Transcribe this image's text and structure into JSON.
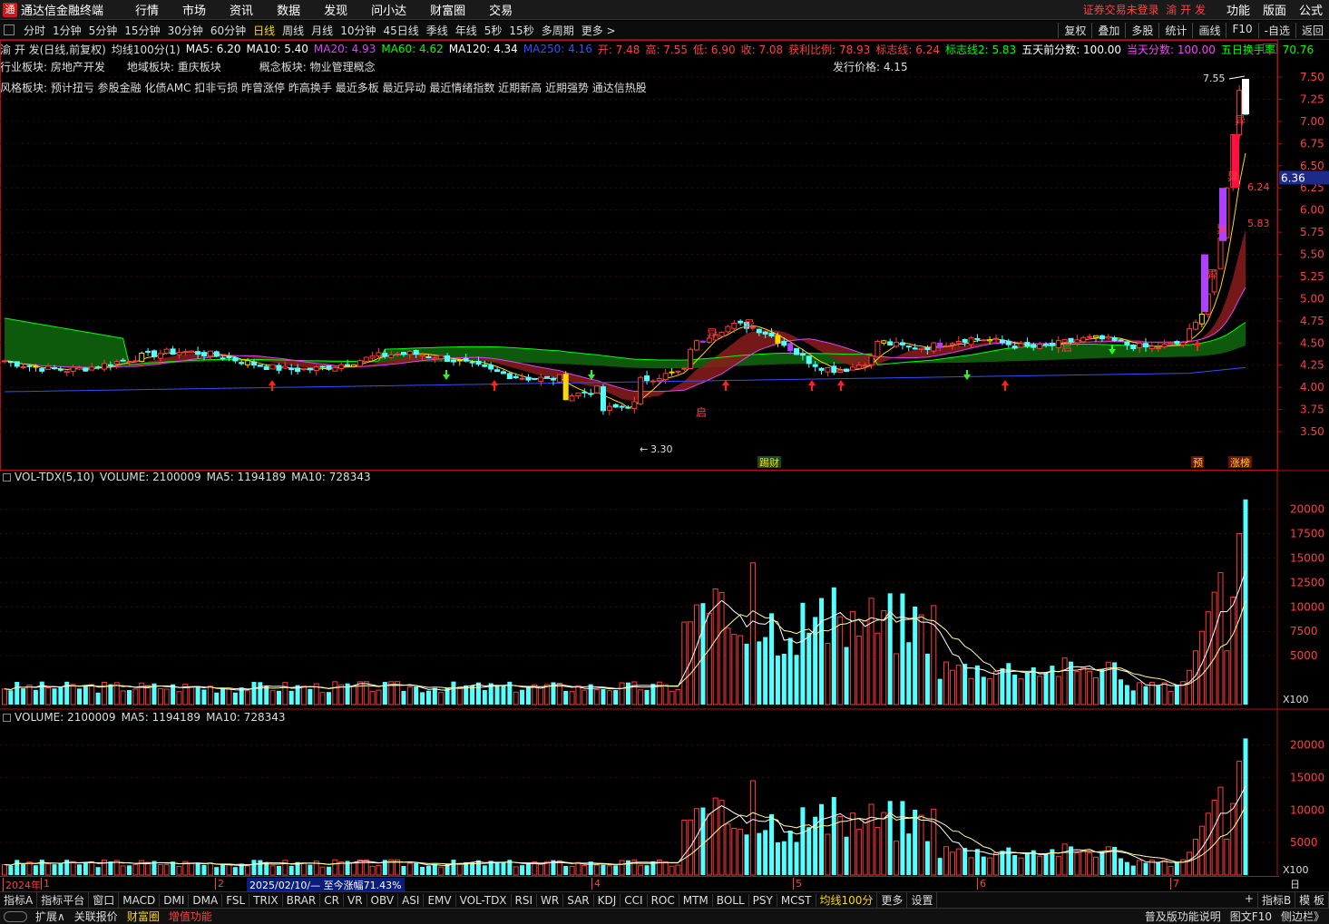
{
  "app": {
    "title": "通达信金融终端",
    "logo": "通"
  },
  "menu": [
    "行情",
    "市场",
    "资讯",
    "数据",
    "发现",
    "问小达",
    "财富圈",
    "交易"
  ],
  "login_warning": "证券交易未登录",
  "stock_name_top": "渝 开 发",
  "right_menu": [
    "功能",
    "版面",
    "公式"
  ],
  "periods": [
    "分时",
    "1分钟",
    "5分钟",
    "15分钟",
    "30分钟",
    "60分钟",
    "日线",
    "周线",
    "月线",
    "10分钟",
    "45日线",
    "季线",
    "年线",
    "5秒",
    "15秒",
    "多周期",
    "更多 >"
  ],
  "active_period": "日线",
  "right_tools": [
    "复权",
    "叠加",
    "多股",
    "统计",
    "画线",
    "F10",
    "-自选",
    "返回"
  ],
  "ma_line": [
    {
      "text": "渝 开 发(日线,前复权)",
      "color": "#dddddd"
    },
    {
      "text": "均线100分(1)",
      "color": "#dddddd"
    },
    {
      "text": "MA5: 6.20",
      "color": "#ffffff"
    },
    {
      "text": "MA10: 5.40",
      "color": "#ffffff"
    },
    {
      "text": "MA20: 4.93",
      "color": "#e040fb"
    },
    {
      "text": "MA60: 4.62",
      "color": "#00ff00"
    },
    {
      "text": "MA120: 4.34",
      "color": "#ffffff"
    },
    {
      "text": "MA250: 4.16",
      "color": "#3050ff"
    },
    {
      "text": "开: 7.48",
      "color": "#ff4040"
    },
    {
      "text": "高: 7.55",
      "color": "#ff4040"
    },
    {
      "text": "低: 6.90",
      "color": "#ff4040"
    },
    {
      "text": "收: 7.08",
      "color": "#ff4040"
    },
    {
      "text": "获利比例: 78.93",
      "color": "#ff4040"
    },
    {
      "text": "标志线: 6.24",
      "color": "#ff4040"
    },
    {
      "text": "标志线2: 5.83",
      "color": "#00ff00"
    },
    {
      "text": "五天前分数: 100.00",
      "color": "#ffffff"
    },
    {
      "text": "当天分数: 100.00",
      "color": "#ff40ff"
    },
    {
      "text": "五日换手率: 70.76",
      "color": "#00ff00"
    }
  ],
  "sectors": {
    "industry": "行业板块: 房地产开发",
    "region": "地域板块: 重庆板块",
    "concept": "概念板块: 物业管理概念",
    "issue_price": "发行价格: 4.15",
    "style": "风格板块: 预计扭亏 参股金融 化债AMC 扣非亏损 昨曾涨停 昨高换手 最近多板 最近异动 最近情绪指数 近期新高 近期强势 通达信热股"
  },
  "price_axis": [
    "7.50",
    "7.25",
    "7.00",
    "6.75",
    "6.50",
    "6.25",
    "6.00",
    "5.75",
    "5.50",
    "5.25",
    "5.00",
    "4.75",
    "4.50",
    "4.25",
    "4.00",
    "3.75",
    "3.50"
  ],
  "current_price_tag": "6.36",
  "annotations": {
    "high": "7.55",
    "low": "3.30",
    "flag1": "6.24",
    "flag2": "5.83",
    "tag_caicai": "踢财",
    "tag_yu": "预",
    "tag_zhangbang": "涨榜",
    "mark_yi": "异",
    "mark_qi": "启"
  },
  "vol_panel1": {
    "title": "VOL-TDX(5,10)",
    "volume": "VOLUME: 2100009",
    "ma5": "MA5: 1194189",
    "ma10": "MA10: 728343"
  },
  "vol_panel2": {
    "volume": "VOLUME: 2100009",
    "ma5": "MA5: 1194189",
    "ma10": "MA10: 728343"
  },
  "vol_axis": [
    "20000",
    "17500",
    "15000",
    "12500",
    "10000",
    "7500",
    "5000"
  ],
  "vol_axis2": [
    "20000",
    "15000",
    "10000",
    "5000"
  ],
  "vol_unit": "X100",
  "date_labels": [
    "2024年",
    "1",
    "2",
    "4",
    "5",
    "6",
    "7"
  ],
  "range_label": "2025/02/10/— 至今涨幅71.43%",
  "date_right": "日线",
  "indicator_tabs": [
    "指标A",
    "指标平台",
    "窗口",
    "MACD",
    "DMI",
    "DMA",
    "FSL",
    "TRIX",
    "BRAR",
    "CR",
    "VR",
    "OBV",
    "ASI",
    "EMV",
    "VOL-TDX",
    "RSI",
    "WR",
    "SAR",
    "KDJ",
    "CCI",
    "ROC",
    "MTM",
    "BOLL",
    "PSY",
    "MCST",
    "均线100分",
    "更多",
    "设置"
  ],
  "active_indicator": "均线100分",
  "indicator_right": [
    "+",
    "指标B",
    "模 板"
  ],
  "status_items": [
    "扩展∧",
    "关联报价",
    "财富圈",
    "增值功能"
  ],
  "status_right": [
    "普及版功能说明",
    "图文F10",
    "侧边栏》"
  ],
  "colors": {
    "up": "#ff3c3c",
    "down": "#54ffff",
    "ma5": "#ffffff",
    "ma20": "#e040fb",
    "ma60": "#00ff00",
    "ma250": "#3050ff",
    "accent": "#ffd700"
  }
}
